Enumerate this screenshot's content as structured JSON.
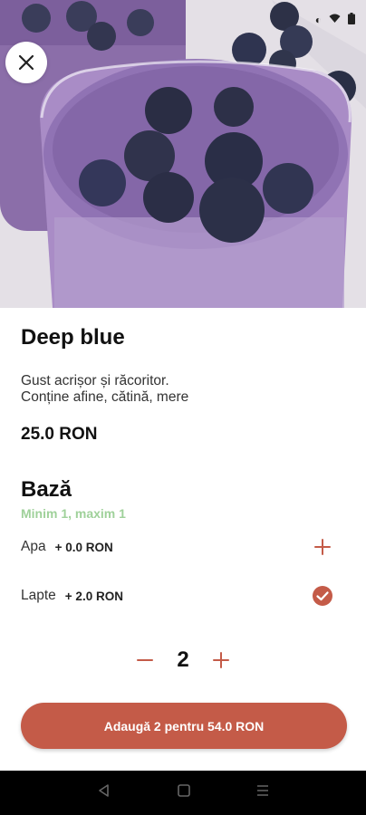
{
  "product": {
    "name": "Deep blue",
    "description_line1": "Gust acrișor și răcoritor.",
    "description_line2": "Conține afine, cătină, mere",
    "price": "25.0 RON"
  },
  "section": {
    "title": "Bază",
    "subtitle": "Minim 1, maxim 1",
    "options": [
      {
        "name": "Apa",
        "price": "+ 0.0 RON",
        "state": "unselected",
        "icon": "plus-icon"
      },
      {
        "name": "Lapte",
        "price": "+ 2.0 RON",
        "state": "selected",
        "icon": "check-circle-icon"
      }
    ]
  },
  "quantity": {
    "value": "2"
  },
  "cta": {
    "label": "Adaugă 2 pentru 54.0 RON"
  },
  "colors": {
    "accent": "#c45b48",
    "subtitle_green": "#9fd19a",
    "smoothie_purple": "#8a6fb0"
  },
  "icons": [
    "close-icon",
    "plus-icon",
    "check-circle-icon",
    "minus-icon",
    "back-icon",
    "home-icon",
    "recents-icon"
  ]
}
